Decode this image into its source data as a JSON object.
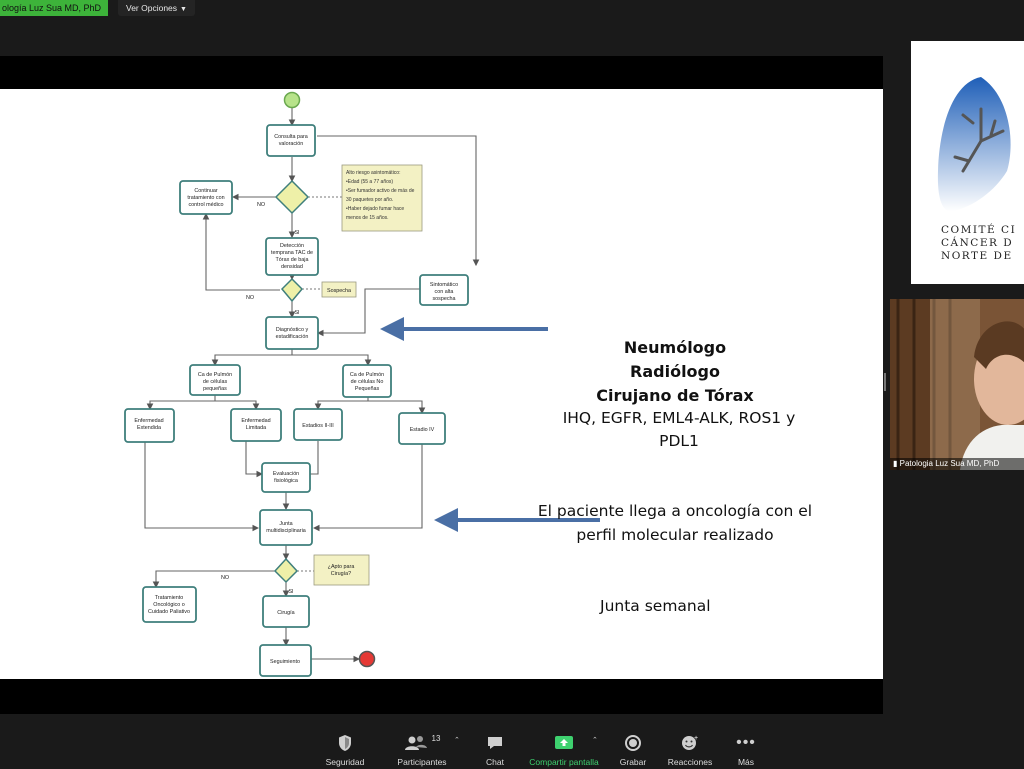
{
  "header": {
    "speaker_label": "ología Luz Sua MD, PhD",
    "view_options_label": "Ver Opciones",
    "view_options_icon": "chevron-down-icon"
  },
  "slide": {
    "flowchart": {
      "consulta": "Consulta para valoración",
      "risk_note": [
        "Alto riesgo asintomático:",
        "•Edad (55 a 77 años)",
        "•Ser fumador activo de más de",
        "30 paquetes por año.",
        "•Haber dejado fumar hace",
        "menos de 15 años."
      ],
      "continuar": "Continuar tratamiento con control médico",
      "no_1": "NO",
      "si_1": "SI",
      "deteccion": "Detección temprana TAC de Tórax de baja densidad",
      "sintomatico": "Sintomático con alta sospecha",
      "sospecha": "Sospecha",
      "no_2": "NO",
      "si_2": "SI",
      "diagnostico": "Diagnóstico y estadificación",
      "ca_pequenas": "Ca de Pulmón de células pequeñas",
      "ca_no_pequenas": "Ca de Pulmón de células No Pequeñas",
      "enf_extendida": "Enfermedad Extendida",
      "enf_limitada": "Enfermedad Limitada",
      "estadios": "Estadios II-III",
      "estadio_iv": "Estadio IV",
      "evaluacion": "Evaluación fisiológica",
      "junta": "Junta multidisciplinaria",
      "apto": "¿Apto para Cirugía?",
      "no_3": "NO",
      "si_3": "SI",
      "tratamiento": "Tratamiento Oncológico o Cuidado Paliativo",
      "cirugia": "Cirugía",
      "seguimiento": "Seguimiento"
    },
    "roles": [
      "Neumólogo",
      "Radiólogo",
      "Cirujano de Tórax"
    ],
    "markers": "IHQ, EGFR, EML4-ALK, ROS1 y PDL1",
    "oncology_note": "El paciente llega a oncología con el perfil molecular realizado",
    "junta_label": "Junta semanal"
  },
  "logo": {
    "lines": [
      "COMITÉ CI",
      "CÁNCER D",
      "NORTE DE"
    ]
  },
  "participant_video": {
    "name": "Patologia Luz Sua MD, PhD"
  },
  "toolbar": {
    "items": [
      {
        "label": "Seguridad",
        "icon": "shield-icon"
      },
      {
        "label": "Participantes",
        "icon": "participants-icon",
        "count": "13"
      },
      {
        "label": "Chat",
        "icon": "chat-icon"
      },
      {
        "label": "Compartir pantalla",
        "icon": "share-screen-icon"
      },
      {
        "label": "Grabar",
        "icon": "record-icon"
      },
      {
        "label": "Reacciones",
        "icon": "reactions-icon"
      },
      {
        "label": "Más",
        "icon": "more-icon"
      }
    ],
    "caret_icon": "caret-up-icon"
  },
  "colors": {
    "speaker_green": "#3db33a",
    "node_border": "#3f7f7c",
    "decision_fill": "#eef0a8",
    "note_fill": "#f3f1c4",
    "arrow_blue": "#4a6fa5",
    "start_green": "#b7e38a",
    "end_red": "#e53935",
    "share_green": "#3ed16f"
  }
}
